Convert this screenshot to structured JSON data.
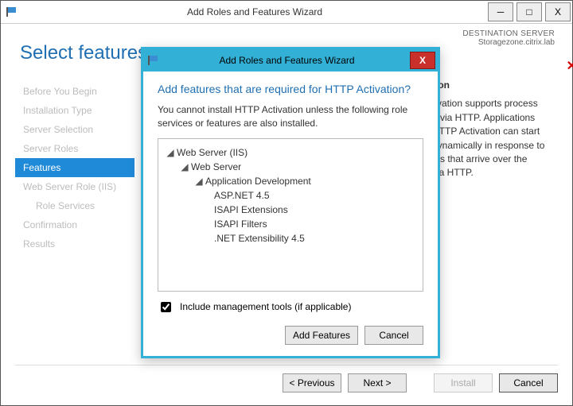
{
  "outer": {
    "title": "Add Roles and Features Wizard",
    "minimize": "─",
    "maximize": "□",
    "close": "X",
    "page_title": "Select features",
    "dest_label": "Destination Server",
    "dest_value": "Storagezone.citrix.lab",
    "nav": [
      "Before You Begin",
      "Installation Type",
      "Server Selection",
      "Server Roles",
      "Features",
      "Web Server Role (IIS)",
      "Role Services",
      "Confirmation",
      "Results"
    ],
    "desc_heading": "tion",
    "desc_body": "tivation supports process\nn via HTTP. Applications\nHTTP Activation can start\ndynamically in response to\nms that arrive over the\nvia HTTP.",
    "btn_prev": "< Previous",
    "btn_next": "Next >",
    "btn_install": "Install",
    "btn_cancel": "Cancel"
  },
  "dialog": {
    "title": "Add Roles and Features Wizard",
    "heading": "Add features that are required for HTTP Activation?",
    "message": "You cannot install HTTP Activation unless the following role services or features are also installed.",
    "tree": {
      "n0": "Web Server (IIS)",
      "n1": "Web Server",
      "n2": "Application Development",
      "c0": "ASP.NET 4.5",
      "c1": "ISAPI Extensions",
      "c2": "ISAPI Filters",
      "c3": ".NET Extensibility 4.5"
    },
    "include_label": "Include management tools (if applicable)",
    "btn_add": "Add Features",
    "btn_cancel": "Cancel"
  }
}
